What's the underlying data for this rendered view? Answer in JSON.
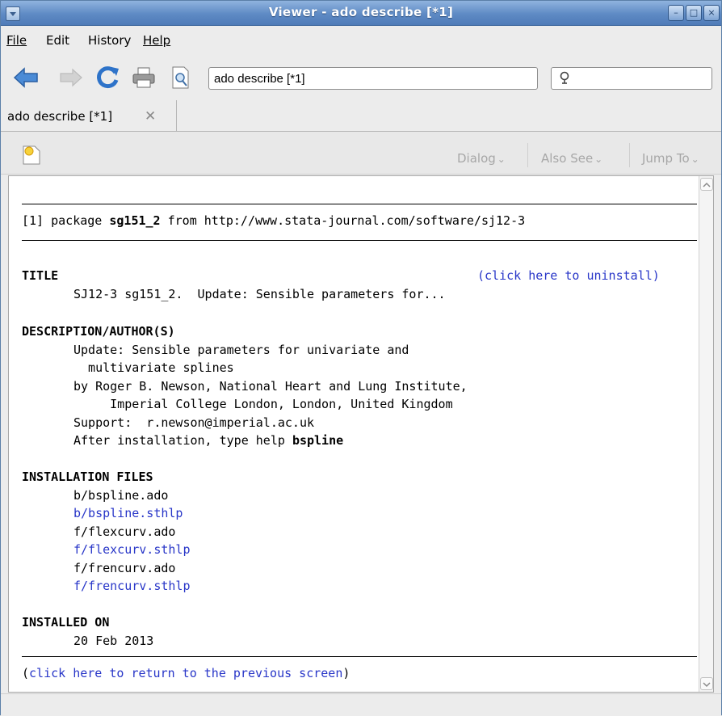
{
  "window": {
    "title": "Viewer - ado describe [*1]"
  },
  "menu": [
    {
      "label": "File",
      "u": "F"
    },
    {
      "label": "Edit",
      "u": "E"
    },
    {
      "label": "History",
      "u": "s"
    },
    {
      "label": "Help",
      "u": "H"
    }
  ],
  "toolbar": {
    "address_value": "ado describe [*1]",
    "search_value": ""
  },
  "tab": {
    "label": "ado describe [*1]"
  },
  "subtoolbar": {
    "dialog": "Dialog",
    "also_see": "Also See",
    "jump_to": "Jump To"
  },
  "content": {
    "pkg_prefix": "[1] package ",
    "pkg_name": "sg151_2",
    "pkg_from": " from http://www.stata-journal.com/software/sj12-3",
    "title_head": "TITLE",
    "uninstall": "(click here to uninstall)",
    "title_text": "SJ12-3 sg151_2.  Update: Sensible parameters for...",
    "desc_head": "DESCRIPTION/AUTHOR(S)",
    "desc_lines": [
      "Update: Sensible parameters for univariate and",
      "  multivariate splines",
      "by Roger B. Newson, National Heart and Lung Institute,",
      "     Imperial College London, London, United Kingdom",
      "Support:  r.newson@imperial.ac.uk"
    ],
    "after_prefix": "After installation, type help ",
    "after_cmd": "bspline",
    "files_head": "INSTALLATION FILES",
    "files": [
      {
        "name": "b/bspline.ado",
        "link": false
      },
      {
        "name": "b/bspline.sthlp",
        "link": true
      },
      {
        "name": "f/flexcurv.ado",
        "link": false
      },
      {
        "name": "f/flexcurv.sthlp",
        "link": true
      },
      {
        "name": "f/frencurv.ado",
        "link": false
      },
      {
        "name": "f/frencurv.sthlp",
        "link": true
      }
    ],
    "installed_head": "INSTALLED ON",
    "installed_date": "20 Feb 2013",
    "return_open": "(",
    "return_link": "click here to return to the previous screen",
    "return_close": ")"
  }
}
